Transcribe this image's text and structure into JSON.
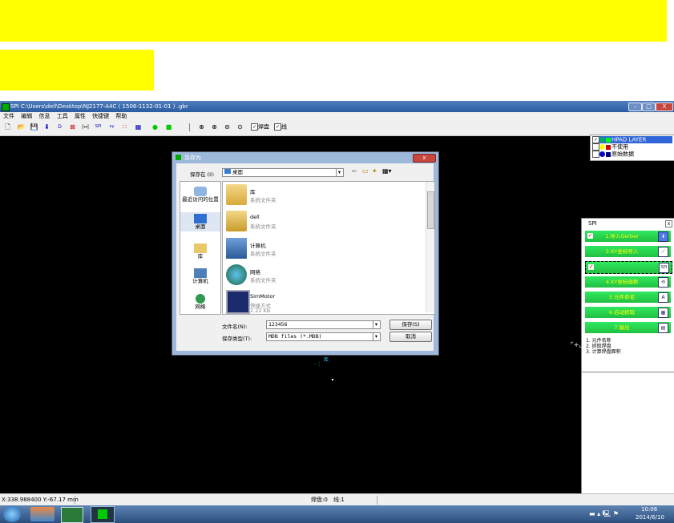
{
  "app": {
    "title": "SPI C:\\Users\\dell\\Desktop\\NJ2177-A4C ( 1506-1132-01-01 ) .gbr",
    "menu": [
      "文件",
      "编辑",
      "信息",
      "工具",
      "属性",
      "快捷键",
      "帮助"
    ],
    "toolbar_checks": [
      {
        "label": "焊盘",
        "checked": true
      },
      {
        "label": "线",
        "checked": true
      }
    ],
    "window_buttons": {
      "minimize": "–",
      "maximize": "□",
      "close": "X"
    }
  },
  "layers": [
    {
      "label": "HPAD LAYER",
      "checked": true,
      "dot": "#00aa66",
      "swatch": "#00ff00",
      "selected": true
    },
    {
      "label": "不使用",
      "checked": false,
      "dot": "#ffff00",
      "swatch": "#cc0000",
      "selected": false
    },
    {
      "label": "原始数据",
      "checked": false,
      "dot": "#0000cc",
      "swatch": "#000080",
      "selected": false
    }
  ],
  "spi_panel": {
    "title": "SPI",
    "close": "x",
    "buttons": [
      {
        "label": "1.导入Gerber",
        "checked": true,
        "icon": "download-icon",
        "glyph": "⬇"
      },
      {
        "label": "2.XY坐标导入",
        "checked": false,
        "icon": "import-xy-icon",
        "glyph": "⟋"
      },
      {
        "label": "",
        "checked": true,
        "icon": "spi-icon",
        "glyph": "SPI"
      },
      {
        "label": "4.XY坐标偏移",
        "checked": false,
        "icon": "offset-icon",
        "glyph": "⟲"
      },
      {
        "label": "5.元件命名",
        "checked": false,
        "icon": "name-icon",
        "glyph": "A"
      },
      {
        "label": "6.自动抓取",
        "checked": false,
        "icon": "grab-icon",
        "glyph": "▦"
      },
      {
        "label": "7.输出",
        "checked": false,
        "icon": "output-icon",
        "glyph": "▤"
      }
    ],
    "notes": [
      "1. 元件名称",
      "2. 抓取焊盘",
      "3. 计算焊盘面积"
    ]
  },
  "status": {
    "coords": "X:338.988400 Y:-67.17 mm",
    "pads": "焊盘:0",
    "lines": "线:1"
  },
  "dialog": {
    "title": "另存为",
    "save_in_label": "保存在 (I):",
    "save_in_value": "桌面",
    "places": [
      "最近访问的位置",
      "桌面",
      "库",
      "计算机",
      "网络"
    ],
    "files": [
      {
        "name": "库",
        "desc": "系统文件夹",
        "desc2": "",
        "icon": "library-folder-icon"
      },
      {
        "name": "dell",
        "desc": "系统文件夹",
        "desc2": "",
        "icon": "user-folder-icon"
      },
      {
        "name": "计算机",
        "desc": "系统文件夹",
        "desc2": "",
        "icon": "computer-icon"
      },
      {
        "name": "网络",
        "desc": "系统文件夹",
        "desc2": "",
        "icon": "network-icon"
      },
      {
        "name": "SimMotor",
        "desc": "快捷方式",
        "desc2": "2.22 KB",
        "icon": "shortcut-icon"
      }
    ],
    "filename_label": "文件名(N):",
    "filename_value": "123456",
    "filetype_label": "保存类型(T):",
    "filetype_value": "MDB files (*.MDB)",
    "save_button": "保存(S)",
    "cancel_button": "取消",
    "close": "x"
  },
  "canvas_label": "库",
  "taskbar": {
    "time": "10:06",
    "date": "2014/6/10"
  }
}
